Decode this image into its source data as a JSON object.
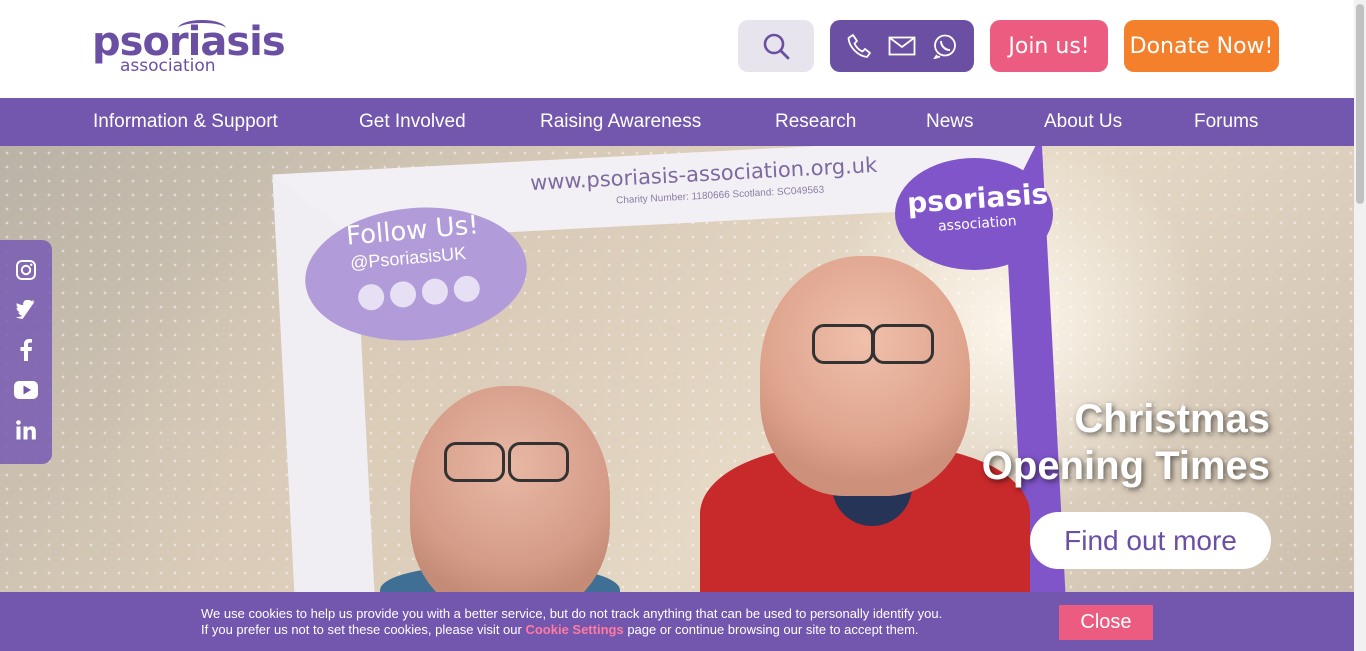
{
  "header": {
    "logo": {
      "line1": "psoriasis",
      "line2": "association"
    },
    "search_icon": "search-icon",
    "contact_icons": [
      "phone-icon",
      "mail-icon",
      "whatsapp-icon"
    ],
    "join_label": "Join us!",
    "donate_label": "Donate Now!"
  },
  "nav": {
    "items": [
      {
        "label": "Information & Support"
      },
      {
        "label": "Get Involved"
      },
      {
        "label": "Raising Awareness"
      },
      {
        "label": "Research"
      },
      {
        "label": "News"
      },
      {
        "label": "About Us"
      },
      {
        "label": "Forums"
      }
    ]
  },
  "hero": {
    "frame_url": "www.psoriasis-association.org.uk",
    "frame_small": "Charity Number: 1180666     Scotland: SC049563",
    "bubble_line1": "Follow Us!",
    "bubble_line2": "@PsoriasisUK",
    "frame_logo_line1": "psoriasis",
    "frame_logo_line2": "association",
    "title_line1": "Christmas",
    "title_line2": "Opening Times",
    "cta_label": "Find out more"
  },
  "social": [
    "instagram-icon",
    "twitter-icon",
    "facebook-icon",
    "youtube-icon",
    "linkedin-icon"
  ],
  "cookie": {
    "line1": "We use cookies to help us provide you with a better service, but do not track anything that can be used to personally identify you.",
    "line2_before": "If you prefer us not to set these cookies, please visit our ",
    "link": "Cookie Settings",
    "line2_after": " page or continue browsing our site to accept them.",
    "close_label": "Close"
  },
  "colors": {
    "brand_purple": "#7356ad",
    "pink": "#ec5b80",
    "orange": "#f5802c"
  }
}
